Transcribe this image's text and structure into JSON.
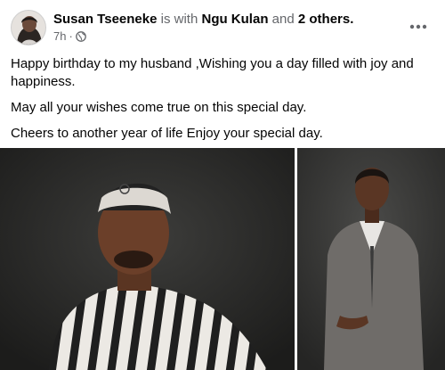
{
  "post": {
    "author": "Susan Tseeneke",
    "with_text": "is with",
    "tagged": "Ngu Kulan",
    "and_text": "and",
    "others": "2 others",
    "period": ".",
    "time": "7h",
    "dot": "·",
    "privacy_icon": "globe-icon",
    "more_icon": "more-horizontal-icon",
    "paragraphs": [
      "Happy birthday to my husband ,Wishing you a day filled with joy and happiness.",
      "May all your wishes come true on this special day.",
      "Cheers to another year of life Enjoy your special day."
    ]
  },
  "colors": {
    "text": "#050505",
    "secondary": "#65676b"
  }
}
